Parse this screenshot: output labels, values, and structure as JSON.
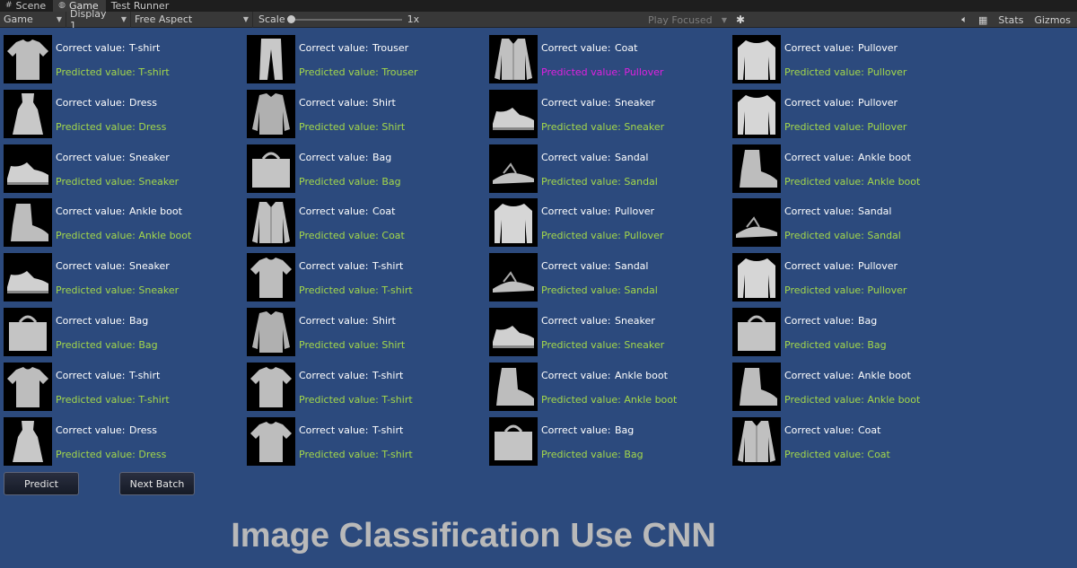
{
  "tabs": [
    {
      "icon": "grid-icon",
      "label": "Scene"
    },
    {
      "icon": "gamepad-icon",
      "label": "Game"
    },
    {
      "icon": "",
      "label": "Test Runner"
    }
  ],
  "toolbar": {
    "view_mode": "Game",
    "display": "Display 1",
    "aspect": "Free Aspect",
    "scale_label": "Scale",
    "scale_value": "1x",
    "play_mode": "Play Focused",
    "stats": "Stats",
    "gizmos": "Gizmos"
  },
  "labels": {
    "correct_prefix": "Correct value:",
    "predicted_prefix": "Predicted value: "
  },
  "grid": {
    "columns": [
      [
        {
          "item": "tshirt",
          "correct": "T-shirt",
          "predicted": "T-shirt"
        },
        {
          "item": "dress",
          "correct": "Dress",
          "predicted": "Dress"
        },
        {
          "item": "sneaker",
          "correct": "Sneaker",
          "predicted": "Sneaker"
        },
        {
          "item": "boot",
          "correct": "Ankle boot",
          "predicted": "Ankle boot"
        },
        {
          "item": "sneaker",
          "correct": "Sneaker",
          "predicted": "Sneaker"
        },
        {
          "item": "bag",
          "correct": "Bag",
          "predicted": "Bag"
        },
        {
          "item": "tshirt",
          "correct": "T-shirt",
          "predicted": "T-shirt"
        },
        {
          "item": "dress",
          "correct": "Dress",
          "predicted": "Dress"
        }
      ],
      [
        {
          "item": "trouser",
          "correct": "Trouser",
          "predicted": "Trouser"
        },
        {
          "item": "shirt",
          "correct": "Shirt",
          "predicted": "Shirt"
        },
        {
          "item": "bag",
          "correct": "Bag",
          "predicted": "Bag"
        },
        {
          "item": "coat",
          "correct": "Coat",
          "predicted": "Coat"
        },
        {
          "item": "tshirt",
          "correct": "T-shirt",
          "predicted": "T-shirt"
        },
        {
          "item": "shirt",
          "correct": "Shirt",
          "predicted": "Shirt"
        },
        {
          "item": "tshirt",
          "correct": "T-shirt",
          "predicted": "T-shirt"
        },
        {
          "item": "tshirt",
          "correct": "T-shirt",
          "predicted": "T-shirt"
        }
      ],
      [
        {
          "item": "coat",
          "correct": "Coat",
          "predicted": "Pullover"
        },
        {
          "item": "sneaker",
          "correct": "Sneaker",
          "predicted": "Sneaker"
        },
        {
          "item": "sandal",
          "correct": "Sandal",
          "predicted": "Sandal"
        },
        {
          "item": "pullover",
          "correct": "Pullover",
          "predicted": "Pullover"
        },
        {
          "item": "sandal",
          "correct": "Sandal",
          "predicted": "Sandal"
        },
        {
          "item": "sneaker",
          "correct": "Sneaker",
          "predicted": "Sneaker"
        },
        {
          "item": "boot",
          "correct": "Ankle boot",
          "predicted": "Ankle boot"
        },
        {
          "item": "bag",
          "correct": "Bag",
          "predicted": "Bag"
        }
      ],
      [
        {
          "item": "pullover",
          "correct": "Pullover",
          "predicted": "Pullover"
        },
        {
          "item": "pullover",
          "correct": "Pullover",
          "predicted": "Pullover"
        },
        {
          "item": "boot",
          "correct": "Ankle boot",
          "predicted": "Ankle boot"
        },
        {
          "item": "sandal",
          "correct": "Sandal",
          "predicted": "Sandal"
        },
        {
          "item": "pullover",
          "correct": "Pullover",
          "predicted": "Pullover"
        },
        {
          "item": "bag",
          "correct": "Bag",
          "predicted": "Bag"
        },
        {
          "item": "boot",
          "correct": "Ankle boot",
          "predicted": "Ankle boot"
        },
        {
          "item": "coat",
          "correct": "Coat",
          "predicted": "Coat"
        }
      ]
    ]
  },
  "buttons": {
    "predict": "Predict",
    "next_batch": "Next Batch"
  },
  "title": "Image Classification Use CNN",
  "colors": {
    "background": "#2c4a7d",
    "correct_prediction": "#a4d84a",
    "wrong_prediction": "#e020e0"
  }
}
